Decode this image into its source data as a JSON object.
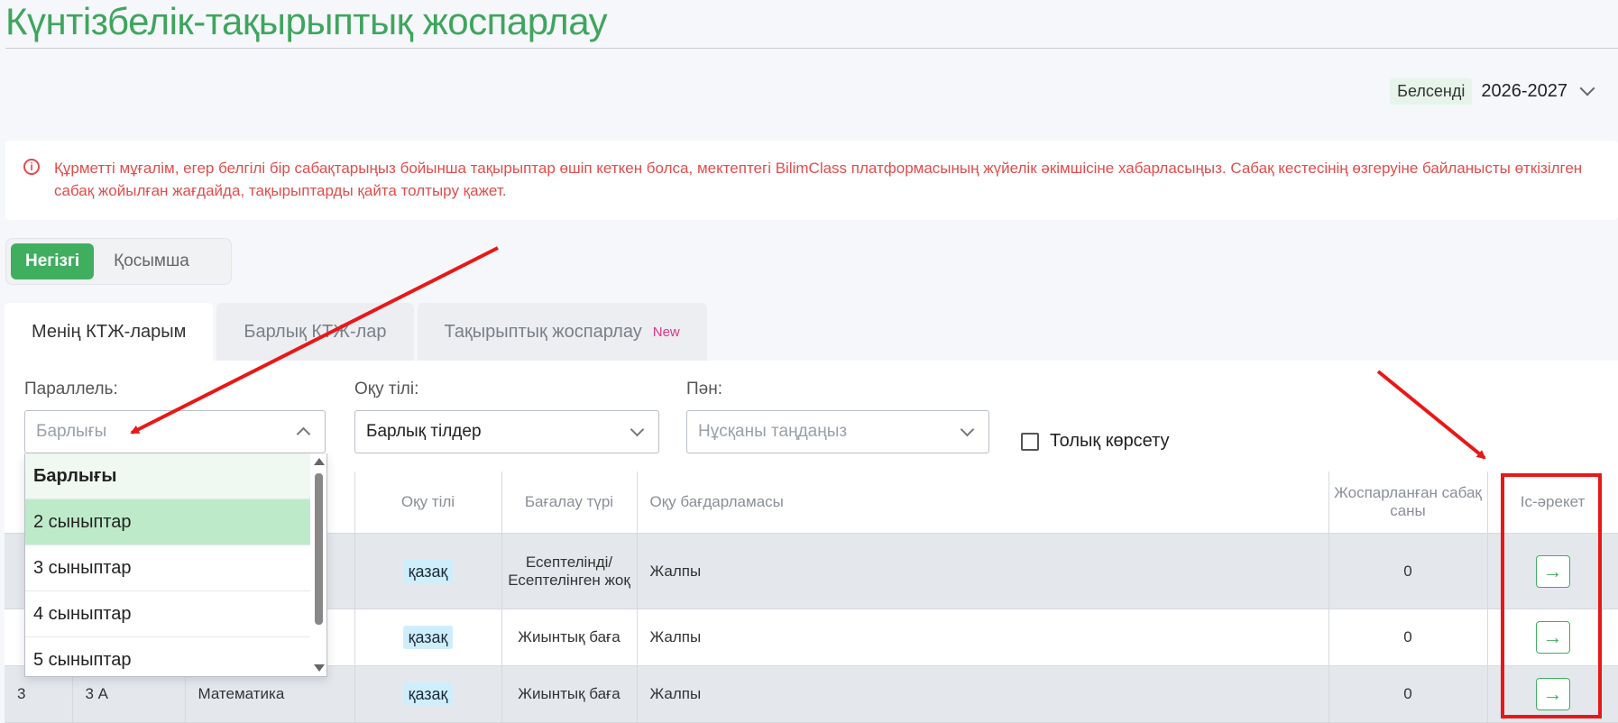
{
  "page": {
    "title": "Күнтізбелік-тақырыптық жоспарлау",
    "active_badge": "Белсенді",
    "academic_year": "2026-2027"
  },
  "alert": {
    "text": "Құрметті мұғалім, егер белгілі бір сабақтарыңыз бойынша тақырыптар өшіп кеткен болса, мектептегі BilimClass платформасының жүйелік әкімшісіне хабарласыңыз. Сабақ кестесінің өзгеруіне байланысты өткізілген сабақ жойылған жағдайда, тақырыптарды қайта толтыру қажет."
  },
  "segment": {
    "main": "Негізгі",
    "extra": "Қосымша"
  },
  "tabs": {
    "my": "Менің КТЖ-ларым",
    "all": "Барлық КТЖ-лар",
    "thematic": "Тақырыптық жоспарлау",
    "new_badge": "New"
  },
  "filters": {
    "parallel_label": "Параллель:",
    "parallel_placeholder": "Барлығы",
    "language_label": "Оқу тілі:",
    "language_value": "Барлық тілдер",
    "subject_label": "Пән:",
    "subject_placeholder": "Нұсқаны таңдаңыз",
    "full_show_label": "Толық көрсету"
  },
  "dropdown": {
    "options": [
      "Барлығы",
      "2 сыныптар",
      "3 сыныптар",
      "4 сыныптар",
      "5 сыныптар"
    ]
  },
  "table": {
    "headers": {
      "language": "Оқу тілі",
      "assessment": "Бағалау түрі",
      "program": "Оқу бағдарламасы",
      "planned": "Жоспарланған сабақ саны",
      "action": "Іс-әрекет"
    },
    "rows": [
      {
        "num": "",
        "class": "",
        "subject": "",
        "language": "қазақ",
        "assessment": "Есептелінді/ Есептелінген жоқ",
        "program": "Жалпы",
        "planned": "0"
      },
      {
        "num": "",
        "class": "",
        "subject": "",
        "language": "қазақ",
        "assessment": "Жиынтық баға",
        "program": "Жалпы",
        "planned": "0"
      },
      {
        "num": "3",
        "class": "3 А",
        "subject": "Математика",
        "language": "қазақ",
        "assessment": "Жиынтық баға",
        "program": "Жалпы",
        "planned": "0"
      }
    ]
  },
  "colors": {
    "accent": "#3fae5f",
    "alert": "#e24c4c",
    "annotation": "#e81818",
    "badge_new": "#e0348a"
  },
  "icons": {
    "alert": "info-circle-icon",
    "action": "arrow-right-icon",
    "dropdown": "chevron-down-icon"
  }
}
